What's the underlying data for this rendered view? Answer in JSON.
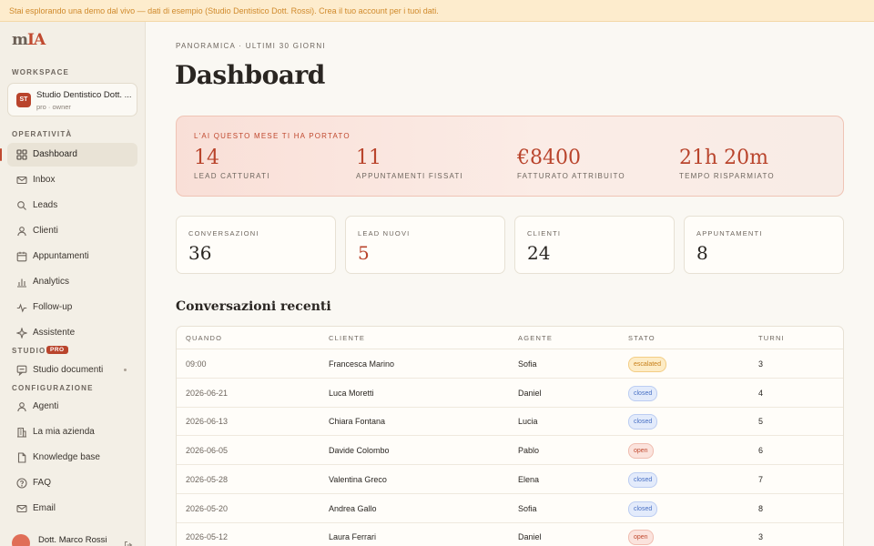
{
  "banner": "Stai esplorando una demo dal vivo — dati di esempio (Studio Dentistico Dott. Rossi). Crea il tuo account per i tuoi dati.",
  "logo": {
    "m": "m",
    "ia": "IA"
  },
  "sidebar": {
    "workspace_label": "Workspace",
    "workspace": {
      "initials": "ST",
      "name": "Studio Dentistico Dott. ...",
      "sub": "pro · owner"
    },
    "operativita_label": "Operatività",
    "operativita_items": [
      {
        "label": "Dashboard",
        "icon": "grid-icon"
      },
      {
        "label": "Inbox",
        "icon": "mail-icon"
      },
      {
        "label": "Leads",
        "icon": "search-icon"
      },
      {
        "label": "Clienti",
        "icon": "user-icon"
      },
      {
        "label": "Appuntamenti",
        "icon": "calendar-icon"
      },
      {
        "label": "Analytics",
        "icon": "bar-chart-icon"
      },
      {
        "label": "Follow-up",
        "icon": "pulse-icon"
      },
      {
        "label": "Assistente",
        "icon": "sparkle-icon"
      }
    ],
    "studio_label": "Studio",
    "studio_badge": "PRO",
    "studio_items": [
      {
        "label": "Studio documenti",
        "icon": "document-chat-icon"
      }
    ],
    "configurazione_label": "Configurazione",
    "configurazione_items": [
      {
        "label": "Agenti",
        "icon": "user-icon"
      },
      {
        "label": "La mia azienda",
        "icon": "building-icon"
      },
      {
        "label": "Knowledge base",
        "icon": "file-icon"
      },
      {
        "label": "FAQ",
        "icon": "help-circle-icon"
      },
      {
        "label": "Email",
        "icon": "mail-icon"
      }
    ],
    "user": {
      "name": "Dott. Marco Rossi",
      "initial": "D"
    }
  },
  "main": {
    "eyebrow": "PANORAMICA · ULTIMI 30 GIORNI",
    "title": "Dashboard",
    "hero": {
      "label": "L'AI questo mese ti ha portato",
      "stats": [
        {
          "value": "14",
          "caption": "Lead catturati"
        },
        {
          "value": "11",
          "caption": "Appuntamenti fissati"
        },
        {
          "value": "€8400",
          "caption": "Fatturato attribuito"
        },
        {
          "value": "21h 20m",
          "caption": "Tempo risparmiato"
        }
      ]
    },
    "kpis": [
      {
        "label": "Conversazioni",
        "value": "36"
      },
      {
        "label": "Lead nuovi",
        "value": "5"
      },
      {
        "label": "Clienti",
        "value": "24"
      },
      {
        "label": "Appuntamenti",
        "value": "8"
      }
    ],
    "recent_title": "Conversazioni recenti",
    "table": {
      "headers": [
        "Quando",
        "Cliente",
        "Agente",
        "Stato",
        "Turni"
      ],
      "rows": [
        {
          "when": "09:00",
          "client": "Francesca Marino",
          "agent": "Sofia",
          "status": "escalated",
          "turns": "3"
        },
        {
          "when": "2026-06-21",
          "client": "Luca Moretti",
          "agent": "Daniel",
          "status": "closed",
          "turns": "4"
        },
        {
          "when": "2026-06-13",
          "client": "Chiara Fontana",
          "agent": "Lucia",
          "status": "closed",
          "turns": "5"
        },
        {
          "when": "2026-06-05",
          "client": "Davide Colombo",
          "agent": "Pablo",
          "status": "open",
          "turns": "6"
        },
        {
          "when": "2026-05-28",
          "client": "Valentina Greco",
          "agent": "Elena",
          "status": "closed",
          "turns": "7"
        },
        {
          "when": "2026-05-20",
          "client": "Andrea Gallo",
          "agent": "Sofia",
          "status": "closed",
          "turns": "8"
        },
        {
          "when": "2026-05-12",
          "client": "Laura Ferrari",
          "agent": "Daniel",
          "status": "open",
          "turns": "3"
        }
      ]
    }
  },
  "colors": {
    "accent": "#c0492f",
    "background": "#faf8f3",
    "sidebar": "#f3efe6"
  }
}
